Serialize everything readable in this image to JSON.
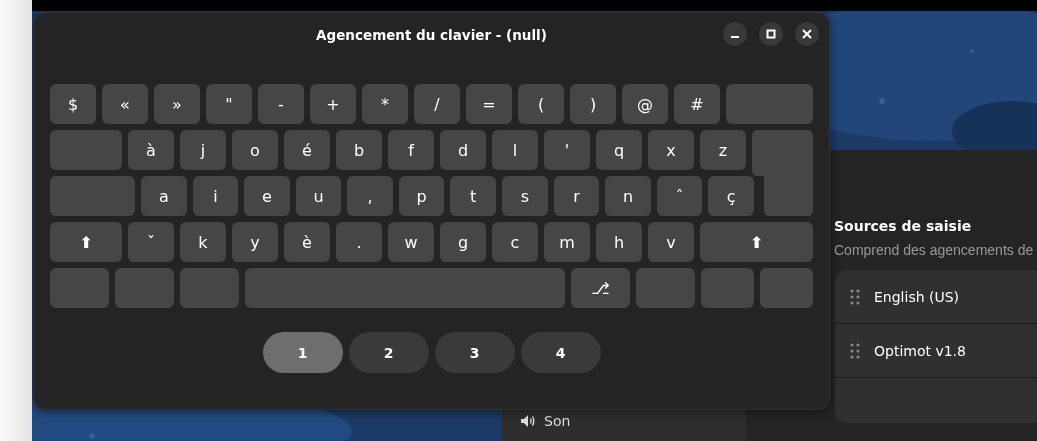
{
  "window": {
    "title": "Agencement du clavier - (null)",
    "controls": [
      {
        "kind": "minimize"
      },
      {
        "kind": "maximize"
      },
      {
        "kind": "close"
      }
    ]
  },
  "keyboard": {
    "rows": [
      [
        {
          "kind": "key",
          "label": "$"
        },
        {
          "kind": "key",
          "label": "«"
        },
        {
          "kind": "key",
          "label": "»"
        },
        {
          "kind": "key",
          "label": "\""
        },
        {
          "kind": "key",
          "label": "-"
        },
        {
          "kind": "key",
          "label": "+"
        },
        {
          "kind": "key",
          "label": "*"
        },
        {
          "kind": "key",
          "label": "/"
        },
        {
          "kind": "key",
          "label": "="
        },
        {
          "kind": "key",
          "label": "("
        },
        {
          "kind": "key",
          "label": ")"
        },
        {
          "kind": "key",
          "label": "@"
        },
        {
          "kind": "key",
          "label": "#"
        },
        {
          "kind": "backspace"
        }
      ],
      [
        {
          "kind": "tab"
        },
        {
          "kind": "key",
          "label": "à"
        },
        {
          "kind": "key",
          "label": "j"
        },
        {
          "kind": "key",
          "label": "o"
        },
        {
          "kind": "key",
          "label": "é"
        },
        {
          "kind": "key",
          "label": "b"
        },
        {
          "kind": "key",
          "label": "f"
        },
        {
          "kind": "key",
          "label": "d"
        },
        {
          "kind": "key",
          "label": "l"
        },
        {
          "kind": "key",
          "label": "'"
        },
        {
          "kind": "key",
          "label": "q"
        },
        {
          "kind": "key",
          "label": "x"
        },
        {
          "kind": "key",
          "label": "z"
        },
        {
          "kind": "enter"
        }
      ],
      [
        {
          "kind": "caps"
        },
        {
          "kind": "key",
          "label": "a"
        },
        {
          "kind": "key",
          "label": "i"
        },
        {
          "kind": "key",
          "label": "e"
        },
        {
          "kind": "key",
          "label": "u"
        },
        {
          "kind": "key",
          "label": ","
        },
        {
          "kind": "key",
          "label": "p"
        },
        {
          "kind": "key",
          "label": "t"
        },
        {
          "kind": "key",
          "label": "s"
        },
        {
          "kind": "key",
          "label": "r"
        },
        {
          "kind": "key",
          "label": "n"
        },
        {
          "kind": "key",
          "label": "ˆ"
        },
        {
          "kind": "key",
          "label": "ç"
        }
      ],
      [
        {
          "kind": "shift",
          "label": "⬆"
        },
        {
          "kind": "key",
          "label": "ˇ"
        },
        {
          "kind": "key",
          "label": "k"
        },
        {
          "kind": "key",
          "label": "y"
        },
        {
          "kind": "key",
          "label": "è"
        },
        {
          "kind": "key",
          "label": "."
        },
        {
          "kind": "key",
          "label": "w"
        },
        {
          "kind": "key",
          "label": "g"
        },
        {
          "kind": "key",
          "label": "c"
        },
        {
          "kind": "key",
          "label": "m"
        },
        {
          "kind": "key",
          "label": "h"
        },
        {
          "kind": "key",
          "label": "v"
        },
        {
          "kind": "rshift",
          "label": "⬆"
        }
      ],
      [
        {
          "kind": "mod"
        },
        {
          "kind": "mod"
        },
        {
          "kind": "mod"
        },
        {
          "kind": "space"
        },
        {
          "kind": "mod",
          "label": "⎇"
        },
        {
          "kind": "mod"
        },
        {
          "kind": "smallmod"
        },
        {
          "kind": "smallmod"
        }
      ]
    ]
  },
  "levels": [
    {
      "label": "1",
      "selected": true
    },
    {
      "label": "2",
      "selected": false
    },
    {
      "label": "3",
      "selected": false
    },
    {
      "label": "4",
      "selected": false
    }
  ],
  "settings": {
    "sidebar": [
      {
        "label": "Son"
      }
    ],
    "input_sources": {
      "title": "Sources de saisie",
      "subtitle": "Comprend des agencements de",
      "items": [
        {
          "label": "English (US)"
        },
        {
          "label": "Optimot v1.8"
        }
      ]
    }
  }
}
